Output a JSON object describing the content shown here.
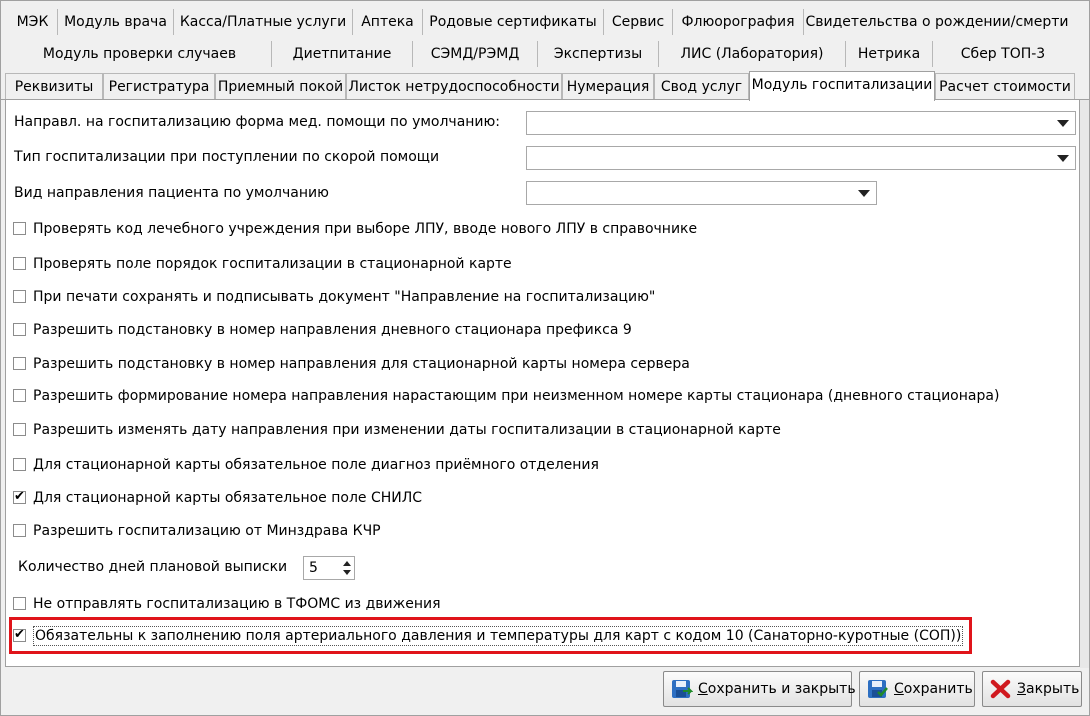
{
  "tabs_row1": [
    "МЭК",
    "Модуль врача",
    "Касса/Платные услуги",
    "Аптека",
    "Родовые сертификаты",
    "Сервис",
    "Флюорография",
    "Свидетельства о рождении/смерти"
  ],
  "tabs_row2": [
    "Модуль проверки случаев",
    "Диетпитание",
    "СЭМД/РЭМД",
    "Экспертизы",
    "ЛИС (Лаборатория)",
    "Нетрика",
    "Сбер ТОП-3"
  ],
  "tabs_row3": [
    "Реквизиты",
    "Регистратура",
    "Приемный покой",
    "Листок нетрудоспособности",
    "Нумерация",
    "Свод услуг",
    "Модуль госпитализации",
    "Расчет стоимости"
  ],
  "active_tab": "Модуль госпитализации",
  "combos": [
    {
      "label": "Направл. на госпитализацию форма мед. помощи по умолчанию:",
      "value": ""
    },
    {
      "label": "Тип госпитализации при поступлении по скорой помощи",
      "value": ""
    },
    {
      "label": "Вид направления пациента по умолчанию",
      "value": ""
    }
  ],
  "checkboxes": [
    {
      "label": "Проверять код лечебного учреждения при выборе ЛПУ, вводе нового ЛПУ в справочнике",
      "checked": false
    },
    {
      "label": "Проверять поле порядок госпитализации в стационарной карте",
      "checked": false
    },
    {
      "label": "При печати сохранять и подписывать документ \"Направление на госпитализацию\"",
      "checked": false
    },
    {
      "label": "Разрешить подстановку в номер направления дневного стационара префикса 9",
      "checked": false
    },
    {
      "label": "Разрешить подстановку в номер направления для стационарной карты номера сервера",
      "checked": false
    },
    {
      "label": "Разрешить формирование номера направления нарастающим при неизменном номере карты стационара (дневного стационара)",
      "checked": false
    },
    {
      "label": "Разрешить изменять дату направления при изменении даты госпитализации в стационарной карте",
      "checked": false
    },
    {
      "label": "Для стационарной карты обязательное поле диагноз приёмного отделения",
      "checked": false
    },
    {
      "label": "Для стационарной карты обязательное поле СНИЛС",
      "checked": true
    },
    {
      "label": "Разрешить госпитализацию от Минздрава КЧР",
      "checked": false
    }
  ],
  "planned_days": {
    "label": "Количество дней плановой выписки",
    "value": "5"
  },
  "tfoms_checkbox": {
    "label": "Не отправлять госпитализацию в ТФОМС из движения",
    "checked": false
  },
  "bp_checkbox": {
    "label": "Обязательны к заполнению поля артериального давления и температуры для карт с кодом 10 (Санаторно-куротные (СОП))",
    "checked": true
  },
  "buttons": {
    "save_close_prefix": "С",
    "save_close_rest": "охранить и закрыть",
    "save_prefix": "С",
    "save_rest": "охранить",
    "close_prefix": "З",
    "close_rest": "акрыть"
  },
  "colors": {
    "highlight": "#e0141a",
    "panel": "#ffffff",
    "window": "#f0f0f0"
  }
}
